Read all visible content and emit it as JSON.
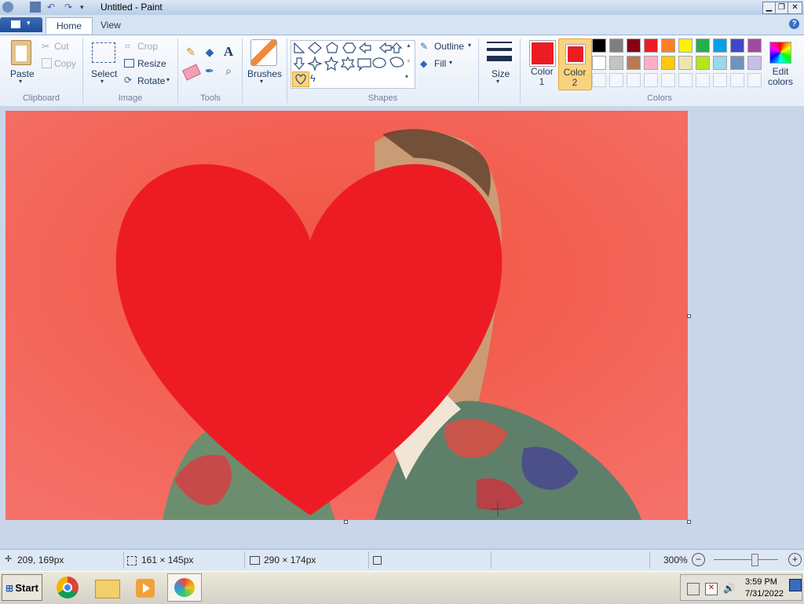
{
  "window": {
    "title": "Untitled - Paint"
  },
  "tabs": {
    "home": "Home",
    "view": "View"
  },
  "clipboard": {
    "paste": "Paste",
    "cut": "Cut",
    "copy": "Copy",
    "label": "Clipboard"
  },
  "image": {
    "select": "Select",
    "crop": "Crop",
    "resize": "Resize",
    "rotate": "Rotate",
    "label": "Image"
  },
  "tools": {
    "label": "Tools"
  },
  "brushes": {
    "label": "Brushes"
  },
  "shapes": {
    "outline": "Outline",
    "fill": "Fill",
    "label": "Shapes"
  },
  "size": {
    "label": "Size"
  },
  "colors": {
    "color1": "Color 1",
    "color2": "Color 2",
    "edit": "Edit colors",
    "label": "Colors",
    "color1_value": "#ed1c24",
    "color2_value": "#ed1c24",
    "palette_row1": [
      "#000000",
      "#7f7f7f",
      "#880015",
      "#ed1c24",
      "#ff7f27",
      "#fff200",
      "#22b14c",
      "#00a2e8",
      "#3f48cc",
      "#a349a4"
    ],
    "palette_row2": [
      "#ffffff",
      "#c3c3c3",
      "#b97a57",
      "#ffaec9",
      "#ffc90e",
      "#efe4b0",
      "#b5e61d",
      "#99d9ea",
      "#7092be",
      "#c8bfe7"
    ]
  },
  "status": {
    "cursor_pos": "209, 169px",
    "selection_size": "161 × 145px",
    "image_size": "290 × 174px",
    "zoom": "300%"
  },
  "taskbar": {
    "start": "Start",
    "time": "3:59 PM",
    "date": "7/31/2022"
  }
}
